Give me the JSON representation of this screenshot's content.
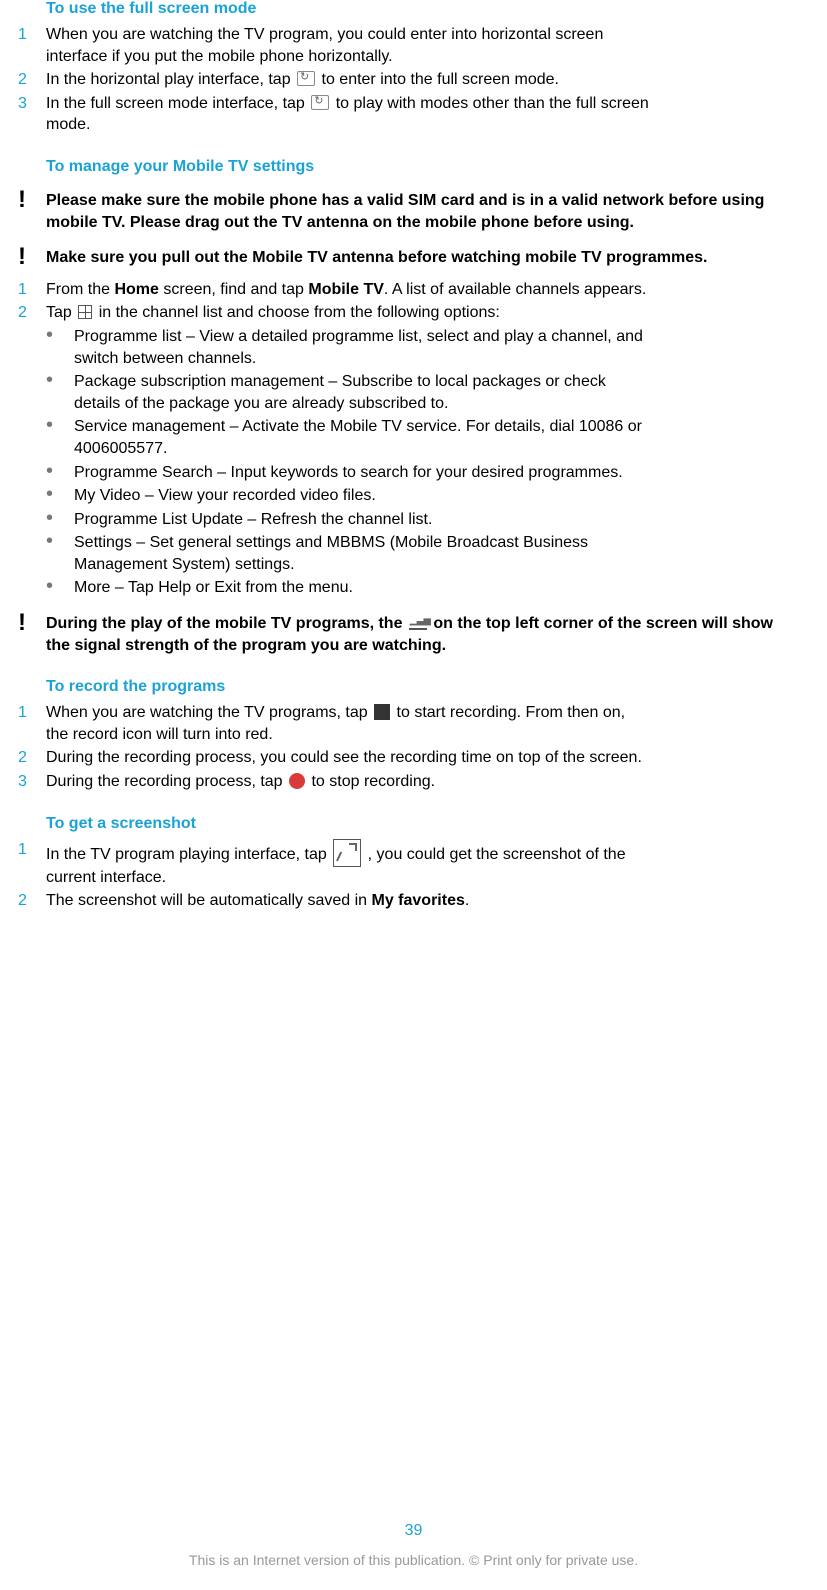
{
  "sections": {
    "fullscreen": {
      "title": "To use the full screen mode",
      "steps": {
        "s1a": "When you are watching the TV program, you could enter into horizontal screen",
        "s1b": "interface if you put the mobile phone horizontally.",
        "s2a": "In the horizontal play interface, tap ",
        "s2b": " to enter into the full screen mode.",
        "s3a": "In the full screen mode interface, tap ",
        "s3b": " to play with modes other than the full screen",
        "s3c": "mode."
      }
    },
    "manage": {
      "title": "To manage your Mobile TV settings",
      "note1a": "Please make sure the mobile phone has a valid SIM card and is in a valid network before using",
      "note1b": "mobile TV. Please drag out the TV antenna on the mobile phone before using.",
      "note2": "Make sure you pull out the Mobile TV antenna before watching mobile TV programmes.",
      "s1a": "From the ",
      "s1home": "Home",
      "s1b": " screen, find and tap ",
      "s1mtv": "Mobile TV",
      "s1c": ". A list of available channels appears.",
      "s2a": "Tap ",
      "s2b": " in the channel list and choose from the following options:",
      "bullets": {
        "b1a": "Programme list – View a detailed programme list, select and play a channel, and",
        "b1b": "switch between channels.",
        "b2a": "Package subscription management – Subscribe to local packages or check",
        "b2b": "details of the package you are already subscribed to.",
        "b3a": "Service management – Activate the Mobile TV service. For details, dial 10086 or",
        "b3b": "4006005577.",
        "b4": "Programme Search – Input keywords to search for your desired programmes.",
        "b5": "My Video – View your recorded video files.",
        "b6": "Programme List Update – Refresh the channel list.",
        "b7a": "Settings – Set general settings and MBBMS (Mobile Broadcast Business",
        "b7b": "Management System) settings.",
        "b8": "More – Tap Help or Exit from the menu."
      },
      "note3a": "During the play of the mobile TV programs, the ",
      "note3b": " on the top left corner of the screen will show",
      "note3c": "the signal strength of the program you are watching."
    },
    "record": {
      "title": "To record the programs",
      "s1a": "When you are watching the TV programs, tap ",
      "s1b": " to start recording. From then on,",
      "s1c": "the record icon will turn into red.",
      "s2": "During the recording process, you could see the recording time on top of the screen.",
      "s3a": "During the recording process, tap ",
      "s3b": " to stop recording."
    },
    "screenshot": {
      "title": "To get a screenshot",
      "s1a": "In the TV program playing interface, tap ",
      "s1b": ", you could get the screenshot of the",
      "s1c": "current interface.",
      "s2a": "The screenshot will be automatically saved in ",
      "s2fav": "My favorites",
      "s2b": "."
    }
  },
  "nums": {
    "n1": "1",
    "n2": "2",
    "n3": "3"
  },
  "icons": {
    "fullscreen": "fullscreen-toggle-icon",
    "grid": "channel-grid-icon",
    "signal": "signal-strength-icon",
    "rec": "record-icon",
    "stop": "stop-record-icon",
    "shot": "screenshot-icon"
  },
  "page_number": "39",
  "footer": "This is an Internet version of this publication. © Print only for private use."
}
